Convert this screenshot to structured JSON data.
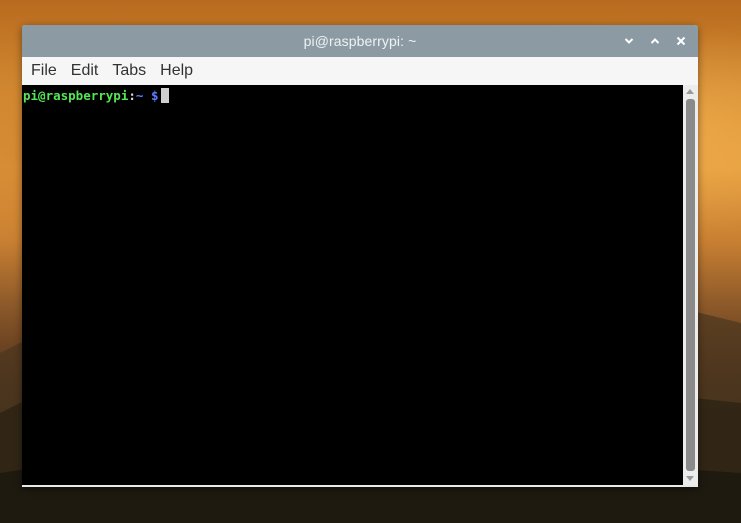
{
  "window": {
    "title": "pi@raspberrypi: ~"
  },
  "menu": {
    "items": [
      "File",
      "Edit",
      "Tabs",
      "Help"
    ]
  },
  "terminal": {
    "user_host": "pi@raspberrypi",
    "colon": ":",
    "path": "~ ",
    "dollar": "$"
  },
  "icons": {
    "minimize": "chevron-down-icon",
    "maximize": "chevron-up-icon",
    "close": "close-icon"
  },
  "colors": {
    "titlebar": "#8c9aa3",
    "terminal_bg": "#000000",
    "prompt_user": "#55e655",
    "prompt_path": "#5a7cff"
  }
}
